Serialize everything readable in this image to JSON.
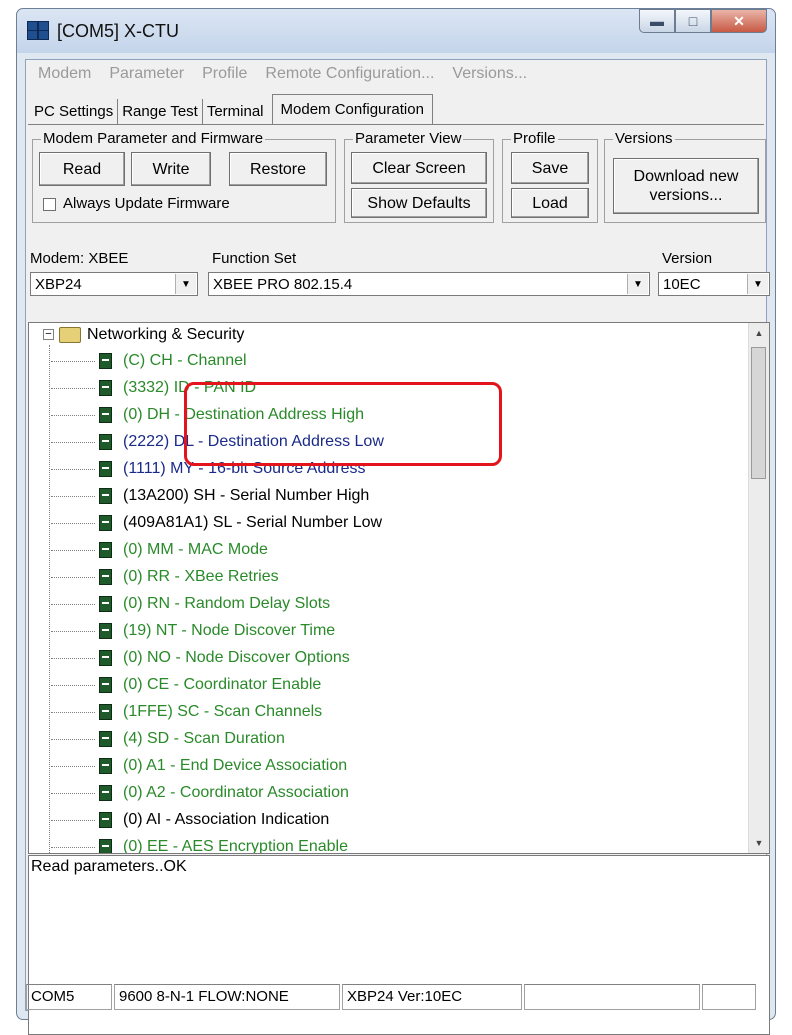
{
  "window": {
    "title": "[COM5] X-CTU"
  },
  "menu": [
    "Modem",
    "Parameter",
    "Profile",
    "Remote Configuration...",
    "Versions..."
  ],
  "tabs": [
    {
      "label": "PC Settings",
      "active": false
    },
    {
      "label": "Range Test",
      "active": false
    },
    {
      "label": "Terminal",
      "active": false
    },
    {
      "label": "Modem Configuration",
      "active": true
    }
  ],
  "groups": {
    "modem_param": {
      "label": "Modem Parameter and Firmware",
      "read": "Read",
      "write": "Write",
      "restore": "Restore",
      "always_update": "Always Update Firmware"
    },
    "param_view": {
      "label": "Parameter View",
      "clear": "Clear Screen",
      "defaults": "Show Defaults"
    },
    "profile": {
      "label": "Profile",
      "save": "Save",
      "load": "Load"
    },
    "versions": {
      "label": "Versions",
      "download": "Download new versions..."
    }
  },
  "selectors": {
    "modem_label": "Modem: XBEE",
    "modem_value": "XBP24",
    "function_label": "Function Set",
    "function_value": "XBEE PRO 802.15.4",
    "version_label": "Version",
    "version_value": "10EC"
  },
  "tree": {
    "root": "Networking & Security",
    "items": [
      {
        "text": "(C) CH - Channel",
        "color": "#2a8a2a"
      },
      {
        "text": "(3332) ID - PAN ID",
        "color": "#2a8a2a"
      },
      {
        "text": "(0) DH - Destination Address High",
        "color": "#2a8a2a"
      },
      {
        "text": "(2222) DL - Destination Address Low",
        "color": "#1a2a8a"
      },
      {
        "text": "(1111) MY - 16-bit Source Address",
        "color": "#1a2a8a"
      },
      {
        "text": "(13A200) SH - Serial Number High",
        "color": "#000000"
      },
      {
        "text": "(409A81A1) SL - Serial Number Low",
        "color": "#000000"
      },
      {
        "text": "(0) MM - MAC Mode",
        "color": "#2a8a2a"
      },
      {
        "text": "(0) RR - XBee Retries",
        "color": "#2a8a2a"
      },
      {
        "text": "(0) RN - Random Delay Slots",
        "color": "#2a8a2a"
      },
      {
        "text": "(19) NT - Node Discover Time",
        "color": "#2a8a2a"
      },
      {
        "text": "(0) NO - Node Discover Options",
        "color": "#2a8a2a"
      },
      {
        "text": "(0) CE - Coordinator Enable",
        "color": "#2a8a2a"
      },
      {
        "text": "(1FFE) SC - Scan Channels",
        "color": "#2a8a2a"
      },
      {
        "text": "(4) SD - Scan Duration",
        "color": "#2a8a2a"
      },
      {
        "text": "(0) A1 - End Device Association",
        "color": "#2a8a2a"
      },
      {
        "text": "(0) A2 - Coordinator Association",
        "color": "#2a8a2a"
      },
      {
        "text": "(0) AI - Association Indication",
        "color": "#000000"
      },
      {
        "text": "(0) EE - AES Encryption Enable",
        "color": "#2a8a2a"
      }
    ]
  },
  "output": {
    "text": "Read parameters..OK"
  },
  "status": {
    "port": "COM5",
    "settings": "9600 8-N-1  FLOW:NONE",
    "modem": "XBP24  Ver:10EC"
  }
}
